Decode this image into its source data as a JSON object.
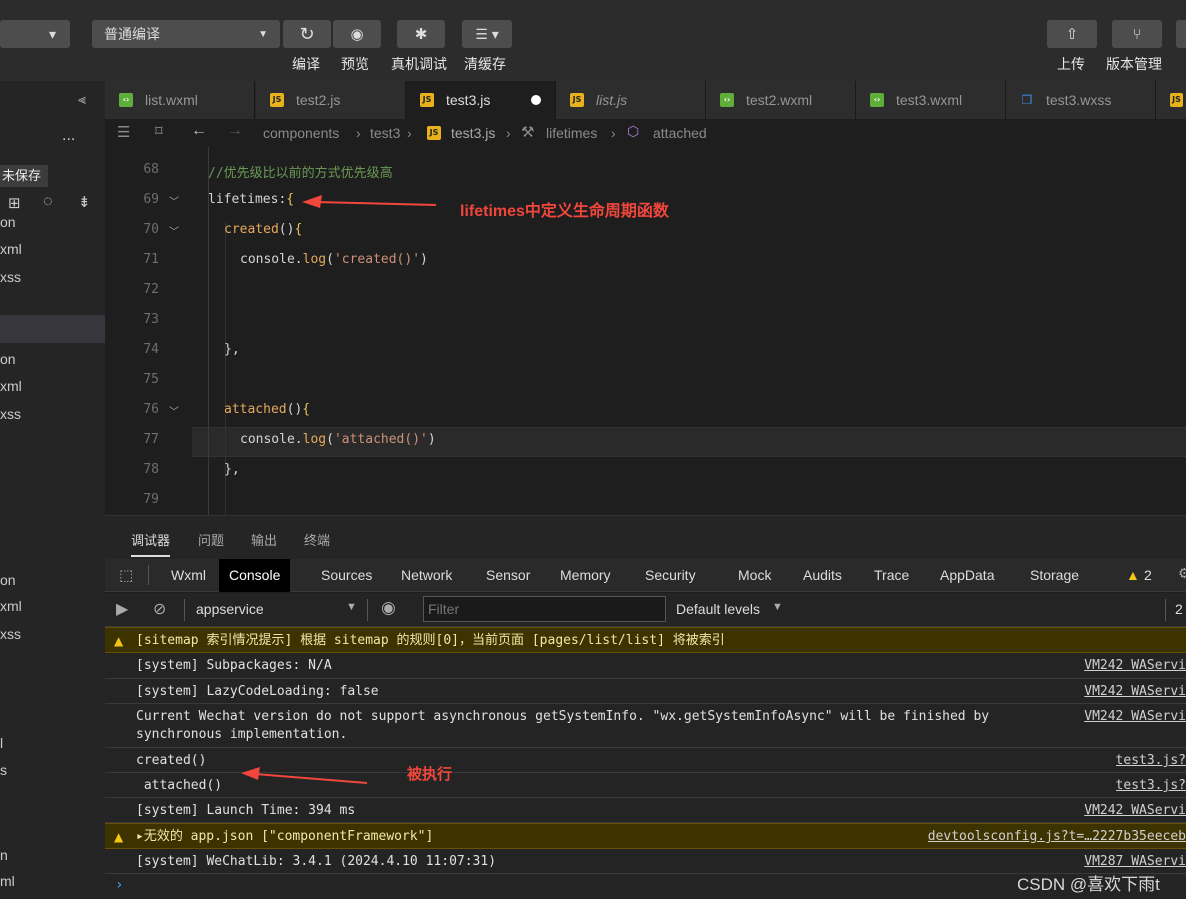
{
  "toolbar": {
    "compile_mode": "普通编译",
    "buttons": [
      "编译",
      "预览",
      "真机调试",
      "清缓存"
    ],
    "right_buttons": [
      "上传",
      "版本管理"
    ]
  },
  "tabs": [
    {
      "name": "list.wxml",
      "icon": "wxml-icon"
    },
    {
      "name": "test2.js",
      "icon": "js-icon"
    },
    {
      "name": "test3.js",
      "icon": "js-icon",
      "active": true,
      "unsaved": true
    },
    {
      "name": "list.js",
      "icon": "js-icon",
      "italic": true
    },
    {
      "name": "test2.wxml",
      "icon": "wxml-icon"
    },
    {
      "name": "test3.wxml",
      "icon": "wxml-icon"
    },
    {
      "name": "test3.wxss",
      "icon": "wxss-icon"
    }
  ],
  "breadcrumb": [
    "components",
    "test3",
    "test3.js",
    "lifetimes",
    "attached"
  ],
  "sidebar": {
    "menu": "...",
    "unsaved_badge": "未保存",
    "files": [
      "on",
      "xml",
      "xss",
      "on",
      "xml",
      "xss",
      "on",
      "xml",
      "xss",
      "l",
      "s",
      "n",
      "ml"
    ]
  },
  "editor": {
    "lines": [
      {
        "n": "68",
        "text": "//优先级比以前的方式优先级高",
        "type": "comment"
      },
      {
        "n": "69",
        "text": "lifetimes:{",
        "fold": true
      },
      {
        "n": "70",
        "text": "created(){",
        "fold": true,
        "indent": 1
      },
      {
        "n": "71",
        "text": "console.log('created()')",
        "indent": 2
      },
      {
        "n": "72",
        "text": ""
      },
      {
        "n": "73",
        "text": ""
      },
      {
        "n": "74",
        "text": "},",
        "indent": 1
      },
      {
        "n": "75",
        "text": ""
      },
      {
        "n": "76",
        "text": "attached(){",
        "fold": true,
        "indent": 1
      },
      {
        "n": "77",
        "text": "console.log('attached()')",
        "indent": 2,
        "highlight": true
      },
      {
        "n": "78",
        "text": "},",
        "indent": 1
      },
      {
        "n": "79",
        "text": ""
      }
    ],
    "annotation": "lifetimes中定义生命周期函数"
  },
  "devtools": {
    "panel_tabs": [
      "调试器",
      "问题",
      "输出",
      "终端"
    ],
    "tabs": [
      "Wxml",
      "Console",
      "Sources",
      "Network",
      "Sensor",
      "Memory",
      "Security",
      "Mock",
      "Audits",
      "Trace",
      "AppData",
      "Storage"
    ],
    "active_tab": "Console",
    "warning_count": "2",
    "context": "appservice",
    "filter_placeholder": "Filter",
    "levels": "Default levels",
    "right_count": "2"
  },
  "console": [
    {
      "text": "[sitemap 索引情况提示] 根据 sitemap 的规则[0]，当前页面 [pages/list/list] 将被索引",
      "type": "warn",
      "src": ""
    },
    {
      "text": "[system] Subpackages: N/A",
      "src": "VM242 WAServi"
    },
    {
      "text": "[system] LazyCodeLoading: false",
      "src": "VM242 WAServi"
    },
    {
      "text": "Current Wechat version do not support asynchronous getSystemInfo. \"wx.getSystemInfoAsync\" will be finished by\nsynchronous implementation.",
      "src": "VM242 WAServi"
    },
    {
      "text": "created()",
      "src": "test3.js? "
    },
    {
      "text": " attached()",
      "src": "test3.js? "
    },
    {
      "text": "[system] Launch Time: 394 ms",
      "src": "VM242 WAServi"
    },
    {
      "text": "▸无效的 app.json [\"componentFramework\"]",
      "type": "warn",
      "src": "devtoolsconfig.js?t=…2227b35eeceb"
    },
    {
      "text": "[system] WeChatLib: 3.4.1 (2024.4.10 11:07:31)",
      "src": "VM287 WAServi"
    }
  ],
  "console_annotation": "被执行",
  "watermark": "CSDN @喜欢下雨t",
  "colors": {
    "accent": "#f0463c",
    "keyword": "#e5a95b",
    "string": "#ce9178",
    "comment": "#6a9955"
  }
}
